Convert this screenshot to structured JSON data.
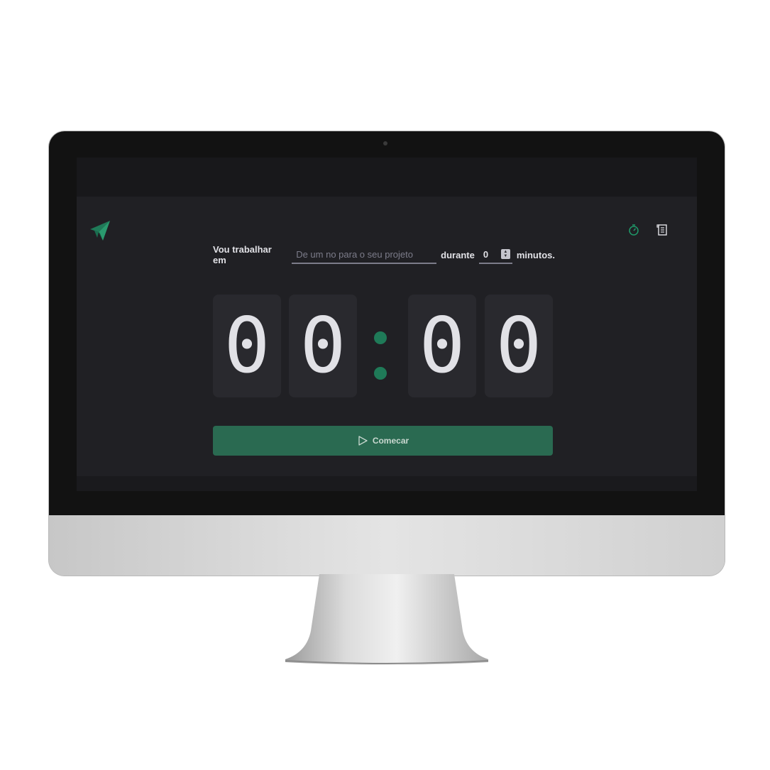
{
  "app": {
    "colors": {
      "accent": "#2a6a51",
      "accent_bright": "#1f7a58",
      "background": "#202024",
      "card": "#29292e",
      "text": "#e1e1e6",
      "placeholder": "#7c7c8a"
    },
    "logo_icon": "paper-plane-logo-icon"
  },
  "header": {
    "nav": [
      {
        "name": "timer",
        "icon": "timer-icon",
        "active": true
      },
      {
        "name": "history",
        "icon": "scroll-icon",
        "active": false
      }
    ]
  },
  "form": {
    "prefix_label": "Vou trabalhar em",
    "task_placeholder": "De um no para o seu projeto",
    "task_value": "",
    "middle_label": "durante",
    "minutes_value": "0",
    "suffix_label": "minutos."
  },
  "countdown": {
    "minutes_tens": "0",
    "minutes_ones": "0",
    "separator": ":",
    "seconds_tens": "0",
    "seconds_ones": "0"
  },
  "start_button": {
    "label": "Comecar",
    "icon": "play-icon"
  }
}
